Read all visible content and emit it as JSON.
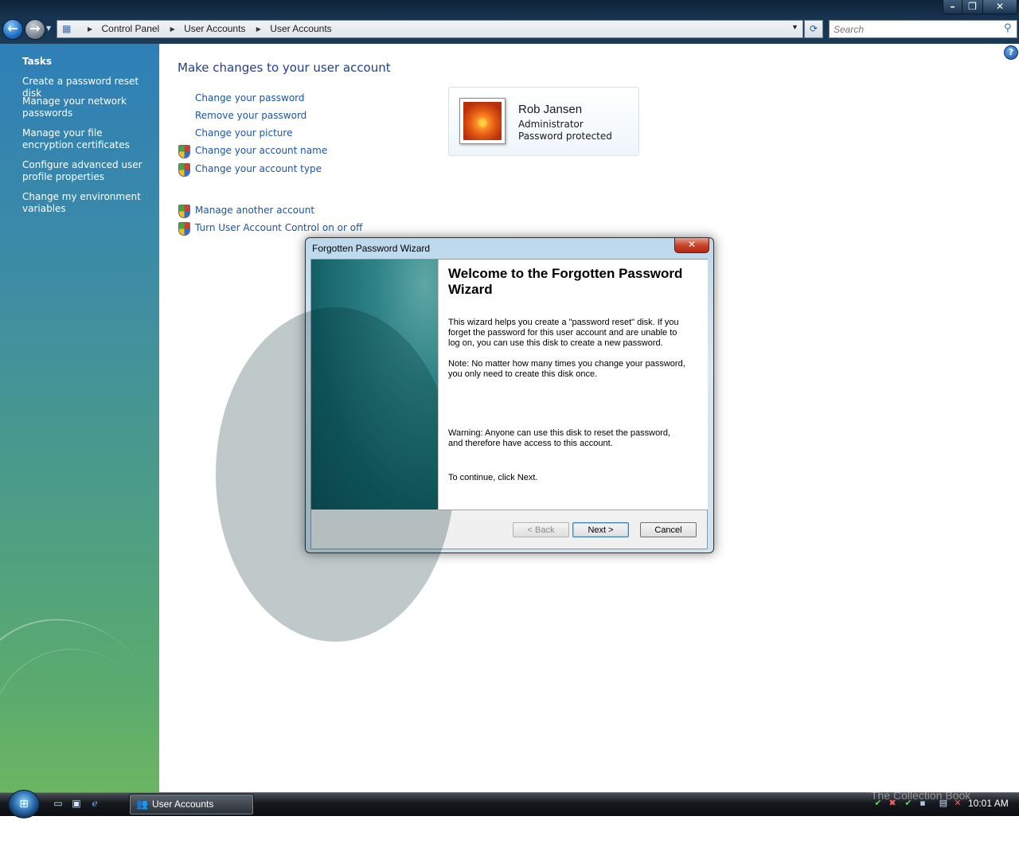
{
  "window": {
    "breadcrumbs": [
      "Control Panel",
      "User Accounts",
      "User Accounts"
    ],
    "search_placeholder": "Search"
  },
  "sidebar": {
    "heading": "Tasks",
    "items": [
      {
        "label": "Create a password reset disk"
      },
      {
        "label": "Manage your network passwords"
      },
      {
        "label": "Manage your file encryption certificates"
      },
      {
        "label": "Configure advanced user profile properties"
      },
      {
        "label": "Change my environment variables"
      }
    ]
  },
  "main": {
    "title": "Make changes to your user account",
    "links": [
      {
        "label": "Change your password",
        "shield": false
      },
      {
        "label": "Remove your password",
        "shield": false
      },
      {
        "label": "Change your picture",
        "shield": false
      },
      {
        "label": "Change your account name",
        "shield": true
      },
      {
        "label": "Change your account type",
        "shield": true
      }
    ],
    "links2": [
      {
        "label": "Manage another account",
        "shield": true
      },
      {
        "label": "Turn User Account Control on or off",
        "shield": true
      }
    ]
  },
  "user": {
    "name": "Rob Jansen",
    "role": "Administrator",
    "status": "Password protected"
  },
  "wizard": {
    "title": "Forgotten Password Wizard",
    "heading": "Welcome to the Forgotten Password Wizard",
    "para1": "This wizard helps you create a \"password reset\" disk. If you forget the password for this user account and are unable to log on, you can use this disk to create a new password.",
    "para2": "Note: No matter how many times you change your password, you only need to create this disk once.",
    "para3": "Warning: Anyone can use this disk to reset the password, and therefore have access to this account.",
    "para4": "To continue, click Next.",
    "back_label": "< Back",
    "next_label": "Next >",
    "cancel_label": "Cancel"
  },
  "taskbar": {
    "active_window": "User Accounts",
    "clock": "10:01 AM",
    "watermark": "The Collection Book"
  },
  "icons": {
    "shield": "uac-shield-icon",
    "help": "help-icon",
    "search": "search-icon"
  },
  "colors": {
    "link": "#1a55a8",
    "title": "#1e3f8c",
    "accent": "#3c7fb1"
  }
}
